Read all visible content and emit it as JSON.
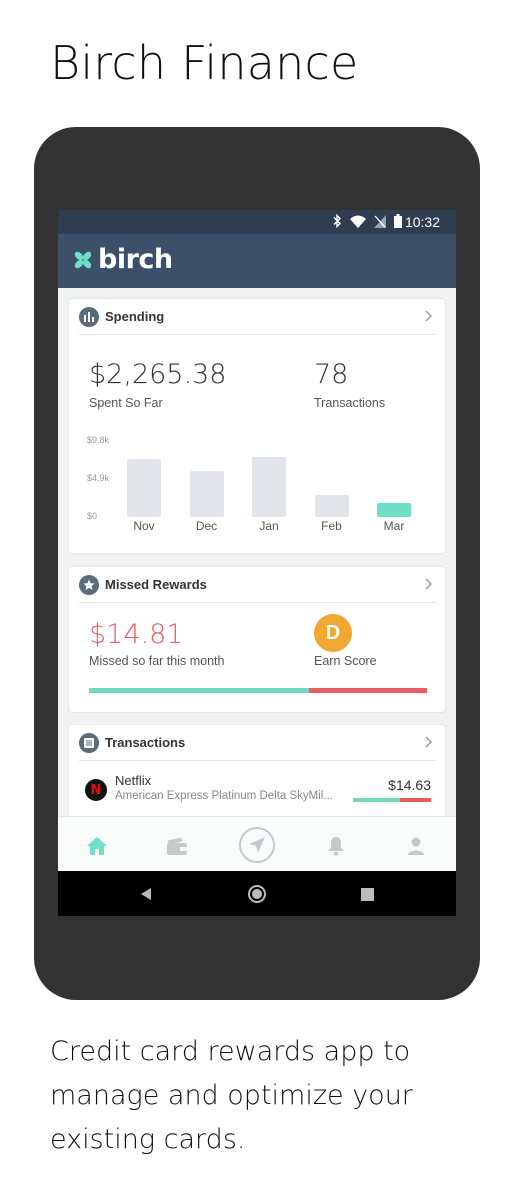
{
  "page": {
    "title": "Birch Finance",
    "caption": "Credit card rewards app to manage and optimize your existing cards."
  },
  "status_bar": {
    "time": "10:32",
    "icons": [
      "bluetooth-icon",
      "wifi-icon",
      "no-signal-icon",
      "battery-icon"
    ]
  },
  "app_bar": {
    "brand": "birch",
    "logo_icon": "birch-leaf-icon"
  },
  "spending": {
    "title": "Spending",
    "amount": "$2,265.38",
    "amount_label": "Spent So Far",
    "transactions_count": "78",
    "transactions_label": "Transactions"
  },
  "chart_data": {
    "type": "bar",
    "categories": [
      "Nov",
      "Dec",
      "Jan",
      "Feb",
      "Mar"
    ],
    "values": [
      7500,
      5900,
      7800,
      2900,
      1800
    ],
    "highlight_index": 4,
    "ytick_labels": [
      "$9.8k",
      "$4.9k",
      "$0"
    ],
    "yticks": [
      9800,
      4900,
      0
    ],
    "ylim": [
      0,
      9800
    ],
    "grid": false,
    "title": "",
    "xlabel": "",
    "ylabel": "",
    "colors": {
      "past": "#e1e4e8",
      "current": "#6fdfc6"
    }
  },
  "missed_rewards": {
    "title": "Missed Rewards",
    "amount": "$14.81",
    "amount_label": "Missed so far this month",
    "score": "D",
    "score_label": "Earn Score",
    "captured_fraction": 0.65
  },
  "transactions": {
    "title": "Transactions",
    "items": [
      {
        "merchant": "Netflix",
        "logo_letter": "N",
        "card": "American Express Platinum Delta SkyMil...",
        "amount": "$14.63",
        "captured_fraction": 0.6
      }
    ]
  },
  "bottom_nav": {
    "items": [
      "home-icon",
      "wallet-icon",
      "navigate-icon",
      "notifications-icon",
      "profile-icon"
    ],
    "active": "home-icon"
  },
  "colors": {
    "app_bar": "#3c5168",
    "accent_green": "#6fdfc6",
    "alert_red": "#ea5f65",
    "score_orange": "#f0a832"
  }
}
